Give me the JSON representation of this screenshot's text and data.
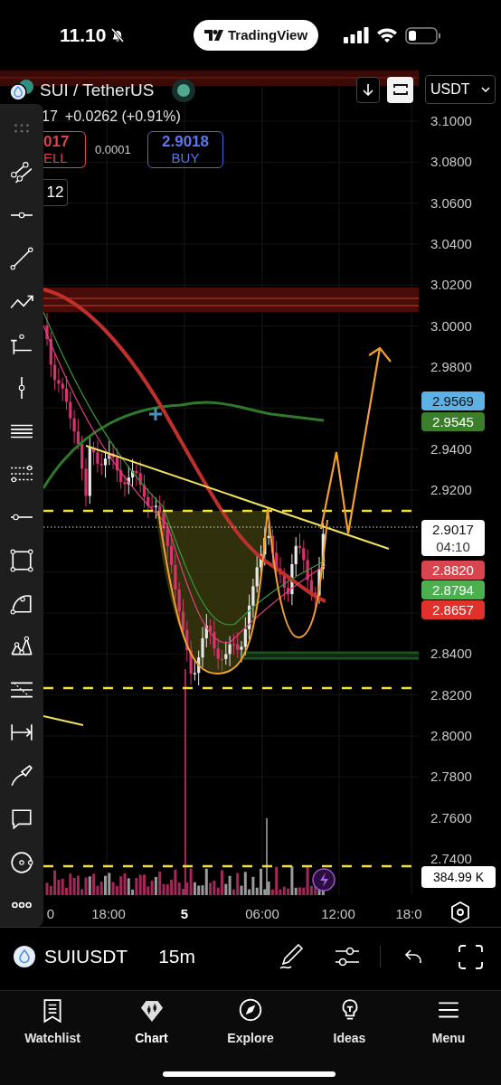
{
  "status_bar": {
    "time": "11.10",
    "app_pill": "TradingView"
  },
  "symbol_header": {
    "title": "SUI / TetherUS",
    "last_digits": "17",
    "change": "+0.0262 (+0.91%)",
    "sell": {
      "price": "017",
      "label": "ELL"
    },
    "spread": "0.0001",
    "buy": {
      "price": "2.9018",
      "label": "BUY"
    },
    "interval_box": "12",
    "currency": "USDT"
  },
  "price_axis": {
    "labels": [
      "3.1000",
      "3.0800",
      "3.0600",
      "3.0400",
      "3.0200",
      "3.0000",
      "2.9800",
      "2.9400",
      "2.9200",
      "2.8400",
      "2.8200",
      "2.8000",
      "2.7800",
      "2.7600",
      "2.7400"
    ]
  },
  "price_badges": [
    {
      "value": "2.9569",
      "color": "#5db1e4"
    },
    {
      "value": "2.9545",
      "color": "#3b7f2b"
    },
    {
      "value": "2.9017",
      "sub": "04:10",
      "color": "#ffffff"
    },
    {
      "value": "2.8820",
      "color": "#d9444e"
    },
    {
      "value": "2.8794",
      "color": "#4caf50"
    },
    {
      "value": "2.8657",
      "color": "#e0322a"
    }
  ],
  "volume_label": "384.99 K",
  "time_axis": [
    {
      "label": "0",
      "bold": false
    },
    {
      "label": "18:00",
      "bold": false
    },
    {
      "label": "5",
      "bold": true
    },
    {
      "label": "06:00",
      "bold": false
    },
    {
      "label": "12:00",
      "bold": false
    },
    {
      "label": "18:0",
      "bold": false
    }
  ],
  "symbol_bar": {
    "symbol": "SUIUSDT",
    "interval": "15m"
  },
  "tabs": [
    {
      "label": "Watchlist",
      "selected": false
    },
    {
      "label": "Chart",
      "selected": true
    },
    {
      "label": "Explore",
      "selected": false
    },
    {
      "label": "Ideas",
      "selected": false
    },
    {
      "label": "Menu",
      "selected": false
    }
  ]
}
